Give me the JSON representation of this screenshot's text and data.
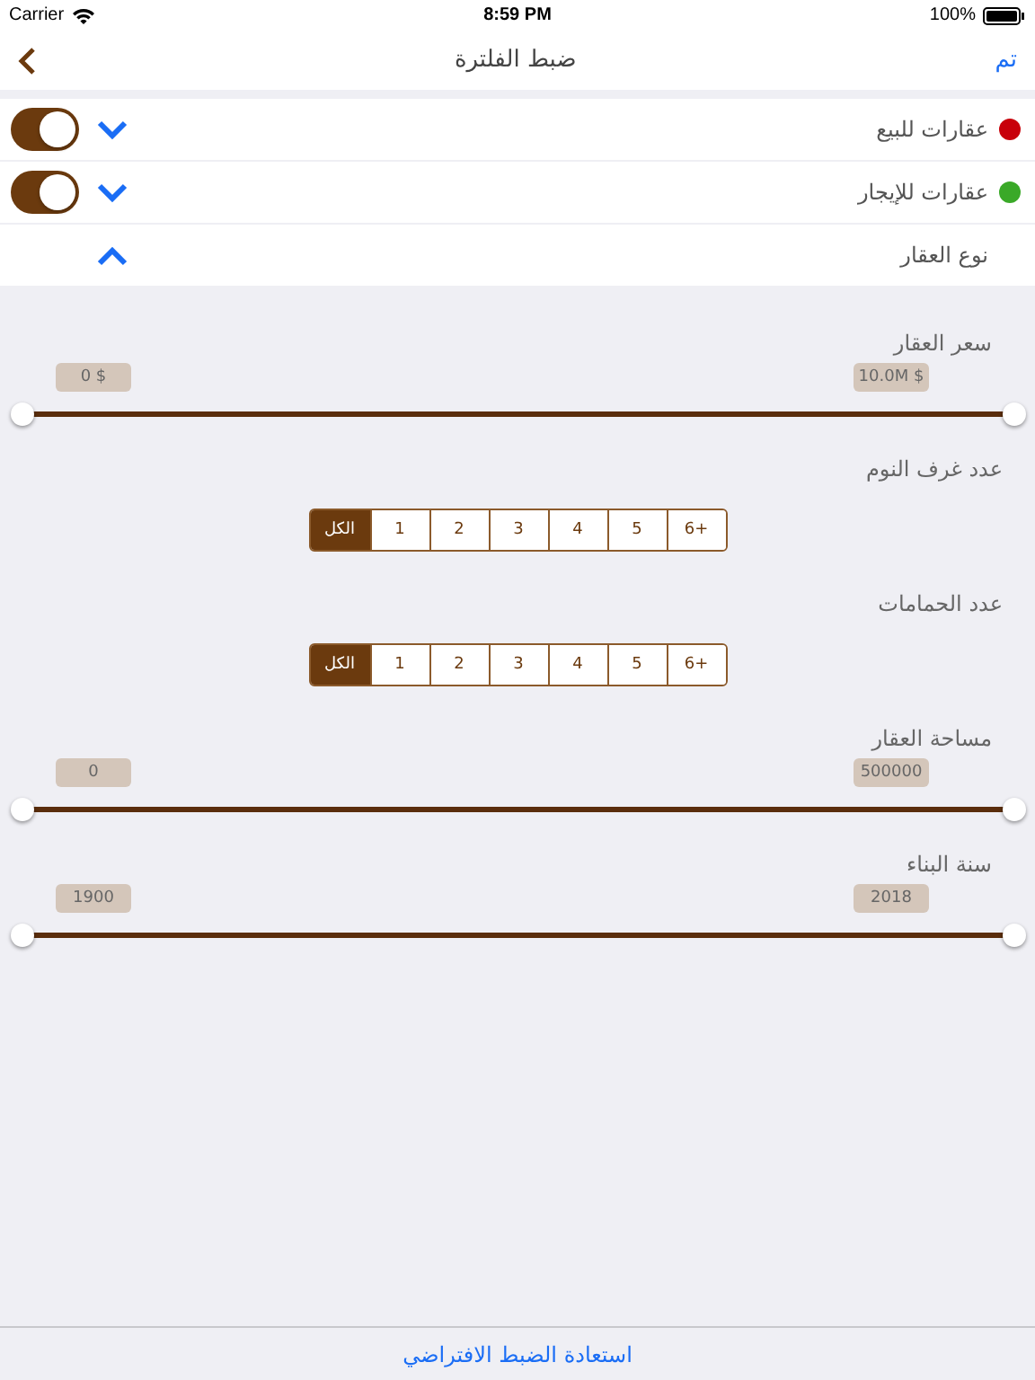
{
  "status_bar": {
    "carrier": "Carrier",
    "time": "8:59 PM",
    "battery": "100%"
  },
  "nav": {
    "done": "تم",
    "title": "ضبط الفلترة"
  },
  "rows": [
    {
      "kind": "toggle",
      "label": "عقارات للبيع",
      "color": "#c8000a",
      "expanded": false,
      "on": true
    },
    {
      "kind": "toggle",
      "label": "عقارات للإيجار",
      "color": "#3aa928",
      "expanded": false,
      "on": true
    },
    {
      "kind": "expand",
      "label": "نوع العقار",
      "expanded": true
    }
  ],
  "filters": [
    {
      "kind": "range",
      "label": "سعر العقار",
      "low": {
        "value": "0 $",
        "level": 0
      },
      "high": {
        "value": "10.0M $",
        "level": 1
      }
    },
    {
      "kind": "segments",
      "label": "عدد غرف النوم",
      "options": [
        {
          "label": "+6",
          "selected": false
        },
        {
          "label": "5",
          "selected": false
        },
        {
          "label": "4",
          "selected": false
        },
        {
          "label": "3",
          "selected": false
        },
        {
          "label": "2",
          "selected": false
        },
        {
          "label": "1",
          "selected": false
        },
        {
          "label": "الكل",
          "selected": true
        }
      ]
    },
    {
      "kind": "segments",
      "label": "عدد الحمامات",
      "options": [
        {
          "label": "+6",
          "selected": false
        },
        {
          "label": "5",
          "selected": false
        },
        {
          "label": "4",
          "selected": false
        },
        {
          "label": "3",
          "selected": false
        },
        {
          "label": "2",
          "selected": false
        },
        {
          "label": "1",
          "selected": false
        },
        {
          "label": "الكل",
          "selected": true
        }
      ]
    },
    {
      "kind": "range",
      "label": "مساحة العقار",
      "low": {
        "value": "0",
        "level": 0
      },
      "high": {
        "value": "500000",
        "level": 1
      }
    },
    {
      "kind": "range",
      "label": "سنة البناء",
      "low": {
        "value": "1900",
        "level": 0
      },
      "high": {
        "value": "2018",
        "level": 1
      }
    }
  ],
  "reset_button": "استعادة الضبط الافتراضي"
}
